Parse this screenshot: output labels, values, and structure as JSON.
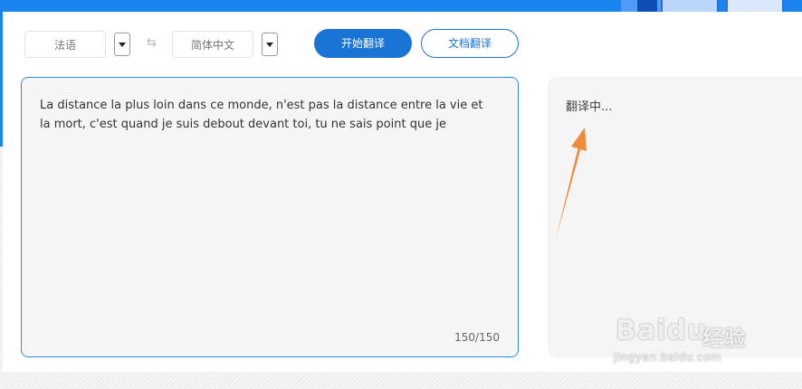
{
  "toolbar": {
    "source_language": "法语",
    "target_language": "简体中文",
    "swap_symbol": "⇆",
    "translate_button": "开始翻译",
    "document_button": "文档翻译"
  },
  "source": {
    "text": "La distance la plus loin dans ce monde, n'est pas la distance entre la vie et la mort, c'est quand je suis debout devant toi, tu ne sais point que je",
    "char_count": "150/150"
  },
  "target": {
    "status": "翻译中..."
  },
  "watermark": {
    "brand": "Baidu",
    "sub": "经验",
    "url": "jingyan.baidu.com"
  },
  "colors": {
    "banner": "#1a85f0",
    "primary": "#1a74d6",
    "source_border": "#2b8fd6",
    "arrow": "#f08a3c"
  },
  "icons": [
    "dropdown-caret-icon",
    "swap-languages-icon",
    "orange-arrow-annotation"
  ]
}
